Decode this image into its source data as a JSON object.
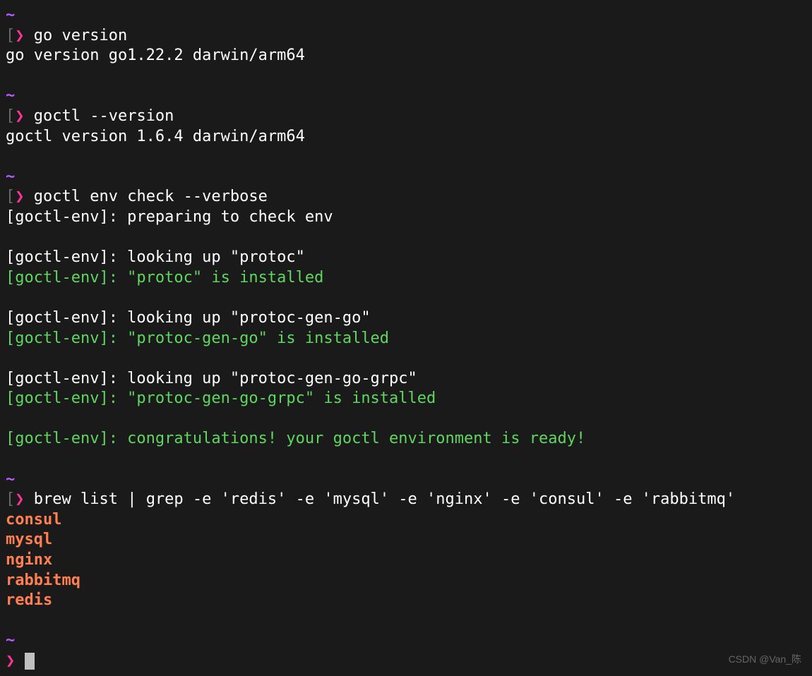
{
  "tilde": "~",
  "bracket": "[",
  "prompt": "❯",
  "commands": {
    "cmd1": "go version",
    "out1": "go version go1.22.2 darwin/arm64",
    "cmd2": "goctl --version",
    "out2": "goctl version 1.6.4 darwin/arm64",
    "cmd3": "goctl env check --verbose",
    "env1": "[goctl-env]: preparing to check env",
    "env2": "[goctl-env]: looking up \"protoc\"",
    "env3": "[goctl-env]: \"protoc\" is installed",
    "env4": "[goctl-env]: looking up \"protoc-gen-go\"",
    "env5": "[goctl-env]: \"protoc-gen-go\" is installed",
    "env6": "[goctl-env]: looking up \"protoc-gen-go-grpc\"",
    "env7": "[goctl-env]: \"protoc-gen-go-grpc\" is installed",
    "env8": "[goctl-env]: congratulations! your goctl environment is ready!",
    "cmd4": "brew list | grep -e 'redis' -e 'mysql' -e 'nginx' -e 'consul' -e 'rabbitmq'",
    "brew1": "consul",
    "brew2": "mysql",
    "brew3": "nginx",
    "brew4": "rabbitmq",
    "brew5": "redis"
  },
  "watermark": "CSDN @Van_陈"
}
